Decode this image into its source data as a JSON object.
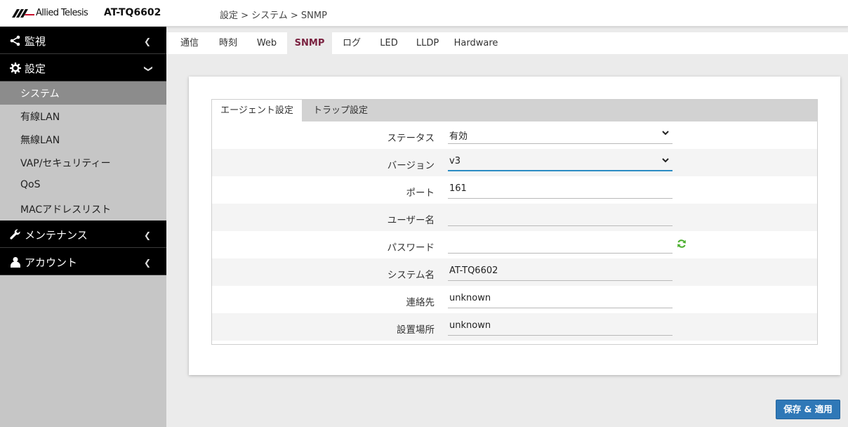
{
  "header": {
    "logo_text": "Allied Telesis",
    "model": "AT-TQ6602",
    "breadcrumb": "設定 > システム > SNMP"
  },
  "sidebar": {
    "sections": [
      {
        "label": "監視",
        "icon": "share-icon",
        "state": "collapsed"
      },
      {
        "label": "設定",
        "icon": "gear-icon",
        "state": "expanded"
      },
      {
        "label": "メンテナンス",
        "icon": "wrench-icon",
        "state": "collapsed"
      },
      {
        "label": "アカウント",
        "icon": "user-icon",
        "state": "collapsed"
      }
    ],
    "items": [
      {
        "label": "システム",
        "active": true
      },
      {
        "label": "有線LAN"
      },
      {
        "label": "無線LAN"
      },
      {
        "label": "VAP/セキュリティー"
      },
      {
        "label": "QoS"
      },
      {
        "label": "MACアドレスリスト"
      }
    ]
  },
  "tabs": [
    "通信",
    "時刻",
    "Web",
    "SNMP",
    "ログ",
    "LED",
    "LLDP",
    "Hardware"
  ],
  "active_tab": "SNMP",
  "subtabs": [
    "エージェント設定",
    "トラップ設定"
  ],
  "form": {
    "status": {
      "label": "ステータス",
      "value": "有効"
    },
    "version": {
      "label": "バージョン",
      "value": "v3"
    },
    "port": {
      "label": "ポート",
      "value": "161"
    },
    "username": {
      "label": "ユーザー名",
      "value": ""
    },
    "password": {
      "label": "パスワード",
      "value": ""
    },
    "system_name": {
      "label": "システム名",
      "value": "AT-TQ6602"
    },
    "contact": {
      "label": "連絡先",
      "value": "unknown"
    },
    "location": {
      "label": "設置場所",
      "value": "unknown"
    }
  },
  "save_label": "保存 & 適用",
  "colors": {
    "accent": "#2f78b7",
    "active_tab_text": "#7a2240",
    "sidebar_dark": "#000000",
    "sidebar_active": "#8c8c8c",
    "refresh_icon": "#4caf2f"
  }
}
